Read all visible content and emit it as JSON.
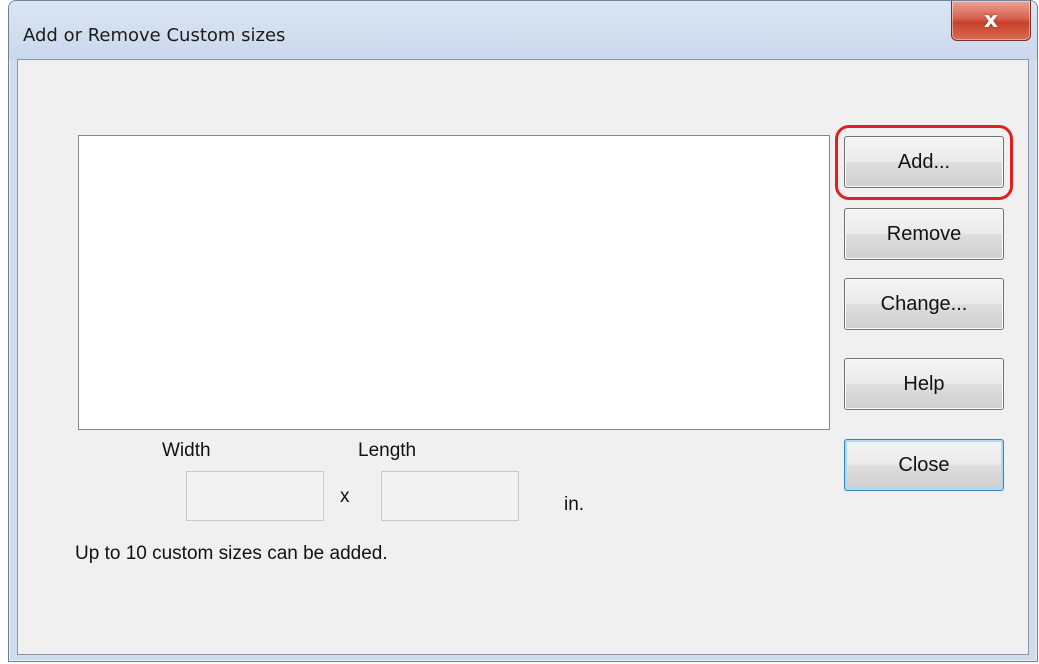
{
  "window": {
    "title": "Add or Remove Custom sizes",
    "close_glyph": "x"
  },
  "list": {
    "items": []
  },
  "buttons": {
    "add": "Add...",
    "remove": "Remove",
    "change": "Change...",
    "help": "Help",
    "close": "Close"
  },
  "size": {
    "width_label": "Width",
    "length_label": "Length",
    "separator": "x",
    "unit": "in.",
    "width_value": "",
    "length_value": ""
  },
  "note": "Up to 10 custom sizes can be added.",
  "colors": {
    "highlight": "#e02020",
    "close_button": "#c8412a",
    "default_button_border": "#3c7fb1"
  }
}
